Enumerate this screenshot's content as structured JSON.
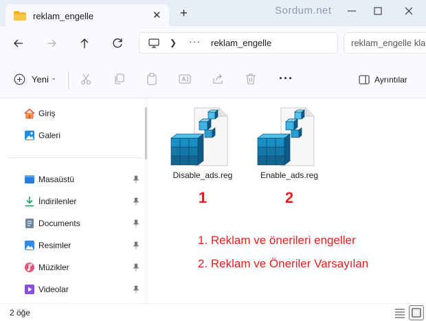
{
  "window": {
    "tab_title": "reklam_engelle",
    "watermark": "Sordum.net"
  },
  "address": {
    "path": "reklam_engelle",
    "overflow": "···",
    "search_placeholder": "reklam_engelle kla"
  },
  "toolbar": {
    "new_label": "Yeni",
    "details_label": "Ayrıntılar",
    "more": "···"
  },
  "sidebar": {
    "top_items": [
      {
        "label": "Giriş",
        "icon": "home-icon"
      },
      {
        "label": "Galeri",
        "icon": "gallery-icon"
      }
    ],
    "pinned_items": [
      {
        "label": "Masaüstü",
        "icon": "desktop-icon"
      },
      {
        "label": "İndirilenler",
        "icon": "download-icon"
      },
      {
        "label": "Documents",
        "icon": "documents-icon"
      },
      {
        "label": "Resimler",
        "icon": "pictures-icon"
      },
      {
        "label": "Müzikler",
        "icon": "music-icon"
      },
      {
        "label": "Videolar",
        "icon": "videos-icon"
      }
    ]
  },
  "files": [
    {
      "name": "Disable_ads.reg",
      "annotation": "1"
    },
    {
      "name": "Enable_ads.reg",
      "annotation": "2"
    }
  ],
  "notes": [
    "1. Reklam ve önerileri engeller",
    "2. Reklam ve Öneriler Varsayılan"
  ],
  "status": {
    "item_count": "2 öğe"
  },
  "colors": {
    "accent": "#0067c0",
    "annotation_red": "#e81e1e",
    "titlebar": "#e8eef7",
    "toolbar_bg": "#f9fafd"
  }
}
